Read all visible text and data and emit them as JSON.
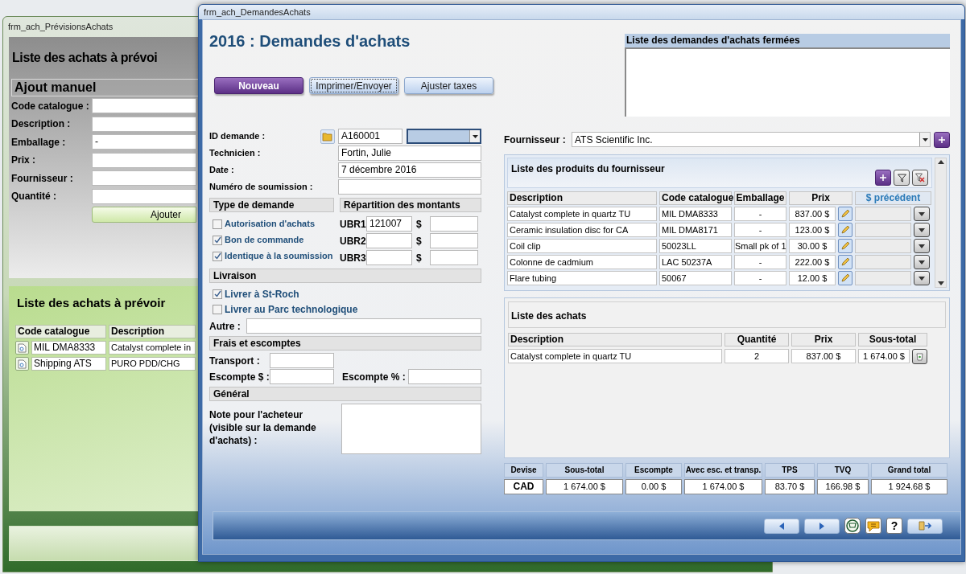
{
  "back_window": {
    "title": "frm_ach_PrévisionsAchats",
    "heading": "Liste des achats à prévoi",
    "manual_add": {
      "title": "Ajout manuel",
      "fields": [
        {
          "label": "Code catalogue :"
        },
        {
          "label": "Description :"
        },
        {
          "label": "Emballage :",
          "value": "-"
        },
        {
          "label": "Prix :"
        },
        {
          "label": "Fournisseur :"
        },
        {
          "label": "Quantité :"
        }
      ],
      "add_button": "Ajouter"
    },
    "planned_list": {
      "title": "Liste des achats à prévoir",
      "columns": [
        "Code catalogue",
        "Description"
      ],
      "rows": [
        {
          "code": "MIL DMA8333",
          "description": "Catalyst complete in"
        },
        {
          "code": "Shipping ATS",
          "description": "PURO PDD/CHG"
        }
      ]
    }
  },
  "front_window": {
    "title": "frm_ach_DemandesAchats",
    "heading": "2016 : Demandes d'achats",
    "buttons": [
      {
        "label": "Nouveau",
        "kind": "primary",
        "focused": false
      },
      {
        "label": "Imprimer/Envoyer",
        "kind": "normal",
        "focused": true
      },
      {
        "label": "Ajuster taxes",
        "kind": "normal",
        "focused": false
      }
    ],
    "request_fields": [
      {
        "label": "ID demande :",
        "kind": "id",
        "value": "A160001"
      },
      {
        "label": "Technicien :",
        "kind": "text",
        "value": "Fortin, Julie"
      },
      {
        "label": "Date :",
        "kind": "text",
        "value": "7 décembre 2016"
      },
      {
        "label": "Numéro de soumission :",
        "kind": "text"
      }
    ],
    "request_type": {
      "title": "Type de demande",
      "options": [
        {
          "label": "Autorisation d'achats",
          "checked": false
        },
        {
          "label": "Bon de commande",
          "checked": true
        },
        {
          "label": "Identique à la soumission",
          "checked": true
        }
      ]
    },
    "amounts": {
      "title": "Répartition des montants",
      "rows": [
        {
          "label": "UBR1",
          "code": "121007",
          "currency": "$"
        },
        {
          "label": "UBR2",
          "currency": "$"
        },
        {
          "label": "UBR3",
          "currency": "$"
        }
      ]
    },
    "delivery": {
      "title": "Livraison",
      "options": [
        {
          "label": "Livrer à St-Roch",
          "checked": true
        },
        {
          "label": "Livrer au Parc technologique",
          "checked": false
        }
      ],
      "other_label": "Autre :"
    },
    "fees": {
      "title": "Frais et escomptes",
      "transport_label": "Transport :",
      "discount_amount_label": "Escompte $ :",
      "discount_percent_label": "Escompte % :"
    },
    "general": {
      "title": "Général",
      "note_label": "Note pour l'acheteur (visible sur la demande d'achats) :"
    },
    "closed_requests": {
      "title": "Liste des demandes d'achats fermées"
    },
    "supplier": {
      "label": "Fournisseur :",
      "value": "ATS Scientific Inc."
    },
    "supplier_products": {
      "title": "Liste des produits du fournisseur",
      "columns": [
        "Description",
        "Code catalogue",
        "Emballage",
        "Prix",
        "$ précédent"
      ],
      "rows": [
        {
          "description": "Catalyst complete in quartz TU",
          "code": "MIL DMA8333",
          "packaging": "-",
          "price": "837.00 $"
        },
        {
          "description": "Ceramic insulation disc for CA",
          "code": "MIL DMA8171",
          "packaging": "-",
          "price": "123.00 $"
        },
        {
          "description": "Coil clip",
          "code": "50023LL",
          "packaging": "Small pk of 1",
          "price": "30.00 $"
        },
        {
          "description": "Colonne de cadmium",
          "code": "LAC 50237A",
          "packaging": "-",
          "price": "222.00 $"
        },
        {
          "description": "Flare tubing",
          "code": "50067",
          "packaging": "-",
          "price": "12.00 $"
        }
      ]
    },
    "purchases": {
      "title": "Liste des achats",
      "columns": [
        "Description",
        "Quantité",
        "Prix",
        "Sous-total"
      ],
      "rows": [
        {
          "description": "Catalyst complete in quartz TU",
          "quantity": "2",
          "price": "837.00 $",
          "subtotal": "1 674.00 $"
        }
      ]
    },
    "totals": {
      "columns": [
        "Devise",
        "Sous-total",
        "Escompte",
        "Avec esc. et transp.",
        "TPS",
        "TVQ",
        "Grand total"
      ],
      "values": [
        "CAD",
        "1 674.00 $",
        "0.00 $",
        "1 674.00 $",
        "83.70 $",
        "166.98 $",
        "1 924.68 $"
      ]
    },
    "navigation": {
      "help_label": "?"
    }
  }
}
